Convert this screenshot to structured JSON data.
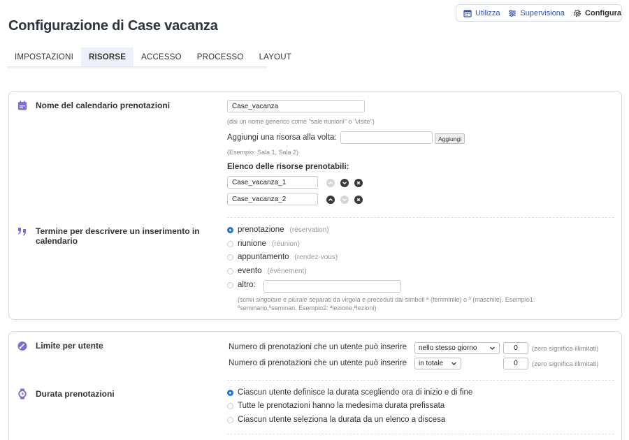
{
  "topnav": {
    "items": [
      {
        "label": "Utilizza",
        "icon": "calendar-icon"
      },
      {
        "label": "Supervisiona",
        "icon": "sliders-icon"
      },
      {
        "label": "Configura",
        "icon": "gear-icon"
      }
    ]
  },
  "page": {
    "title": "Configurazione di Case vacanza"
  },
  "tabs": [
    {
      "label": "IMPOSTAZIONI"
    },
    {
      "label": "RISORSE"
    },
    {
      "label": "ACCESSO"
    },
    {
      "label": "PROCESSO"
    },
    {
      "label": "LAYOUT"
    }
  ],
  "active_tab": "RISORSE",
  "calendar_name": {
    "title": "Nome del calendario prenotazioni",
    "value": "Case_vacanza",
    "hint": "(dai un nome generico come \"sale riunioni\" o \"visite\")"
  },
  "add_resource": {
    "label": "Aggiungi una risorsa alla volta:",
    "value": "",
    "button": "Aggiungi",
    "hint": "(Esempio: Sala 1, Sala 2)"
  },
  "resources": {
    "title": "Elenco delle risorse prenotabili:",
    "items": [
      {
        "value": "Case_vacanza_1"
      },
      {
        "value": "Case_vacanza_2"
      }
    ]
  },
  "term": {
    "title": "Termine per descrivere un inserimento in calendario",
    "options": [
      {
        "label": "prenotazione",
        "sub": "(réservation)",
        "checked": true
      },
      {
        "label": "riunione",
        "sub": "(réunion)",
        "checked": false
      },
      {
        "label": "appuntamento",
        "sub": "(rendez-vous)",
        "checked": false
      },
      {
        "label": "evento",
        "sub": "(événement)",
        "checked": false
      },
      {
        "label": "altro:",
        "sub": "",
        "checked": false
      }
    ],
    "other_value": "",
    "help_1": "(scrivi ",
    "help_singolare": "singolare",
    "help_2": " e ",
    "help_plurale": "plurale",
    "help_3": " separati da virgola e preceduti dai simboli ª (femminile) o º (maschile). Esempio1:",
    "help_line2": "ºseminario,ºseminari. Esempio2: ªlezione,ªlezioni)"
  },
  "user_limit": {
    "title": "Limite per utente",
    "rows": [
      {
        "label": "Numero di prenotazioni che un utente può inserire",
        "select": "nello stesso giorno",
        "value": "0",
        "hint": "(zero significa illimitati)"
      },
      {
        "label": "Numero di prenotazioni che un utente può inserire",
        "select": "in totale",
        "value": "0",
        "hint": "(zero significa illimitati)"
      }
    ]
  },
  "duration": {
    "title": "Durata prenotazioni",
    "options": [
      {
        "label": "Ciascun utente definisce la durata scegliendo ora di inizio e di fine",
        "checked": true
      },
      {
        "label": "Tutte le prenotazioni hanno la medesima durata prefissata",
        "checked": false
      },
      {
        "label": "Ciascun utente seleziona la durata da un elenco a discesa",
        "checked": false
      }
    ]
  },
  "colors": {
    "accent": "#1a73e8",
    "nav_link": "#2f55b8",
    "section_icon": "#7b6fd6",
    "active_tab_bg": "#eef0f9"
  }
}
